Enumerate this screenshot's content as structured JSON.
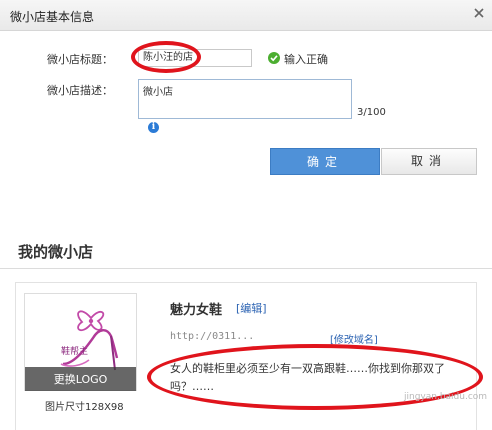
{
  "dialog": {
    "title": "微小店基本信息",
    "close_label": "×",
    "shop_title_label": "微小店标题：",
    "shop_title_value": "陈小汪的店",
    "validation_text": "输入正确",
    "desc_label": "微小店描述：",
    "desc_value": "微小店",
    "counter": "3/100",
    "info_glyph": "i",
    "confirm_label": "确定",
    "cancel_label": "取消"
  },
  "panel": {
    "title": "我的微小店",
    "logo_brand_text": "鞋帮主",
    "change_logo_label": "更换LOGO",
    "logo_size_text": "图片尺寸128X98",
    "shop_name": "魅力女鞋",
    "edit_label": "[编辑]",
    "url_text": "http://0311...",
    "modify_domain_label": "[修改域名]",
    "description": "女人的鞋柜里必须至少有一双高跟鞋……你找到你那双了吗？……"
  },
  "watermark": "jingyan.baidu.com",
  "icons": [
    "close-icon",
    "check-icon",
    "info-icon",
    "high-heel-logo"
  ],
  "colors": {
    "annotation_red": "#e0141c",
    "primary_blue": "#4f91d8",
    "success_green": "#4cae30",
    "link_blue": "#2d64b3"
  }
}
